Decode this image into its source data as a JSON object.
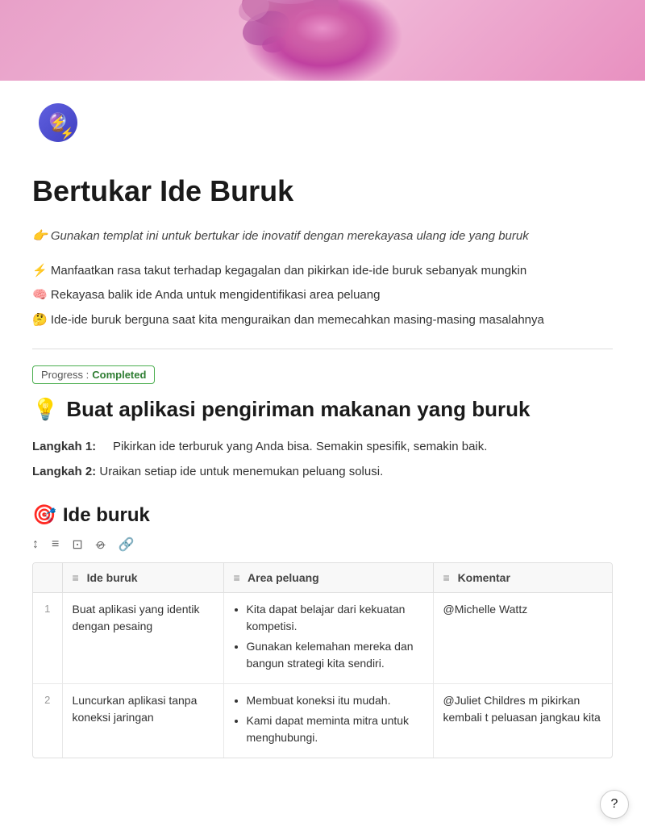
{
  "header": {
    "banner_alt": "Pink decorative header banner"
  },
  "app_icon": {
    "emoji": "🔮⚡"
  },
  "page": {
    "title": "Bertukar Ide Buruk",
    "intro_emoji": "👉",
    "intro_text": "Gunakan templat ini untuk bertukar ide inovatif dengan merekayasa ulang ide yang buruk",
    "bullets": [
      {
        "emoji": "⚡",
        "text": "Manfaatkan rasa takut terhadap kegagalan dan pikirkan ide-ide buruk sebanyak mungkin"
      },
      {
        "emoji": "🧠",
        "text": "Rekayasa balik ide Anda untuk mengidentifikasi area peluang"
      },
      {
        "emoji": "🤔",
        "text": "Ide-ide buruk berguna saat kita menguraikan dan memecahkan masing-masing masalahnya"
      }
    ]
  },
  "progress": {
    "label": "Progress : ",
    "status": "Completed"
  },
  "section1": {
    "emoji": "💡",
    "title": "Buat aplikasi pengiriman makanan yang buruk",
    "steps": [
      {
        "label": "Langkah 1:",
        "text": "Pikirkan ide terburuk yang Anda bisa. Semakin spesifik, semakin baik."
      },
      {
        "label": "Langkah 2:",
        "text": "Uraikan setiap ide untuk menemukan peluang solusi."
      }
    ]
  },
  "section2": {
    "emoji": "🎯",
    "title": "Ide buruk",
    "toolbar": [
      "↕",
      "≡",
      "⊡",
      "⊘",
      "🔗"
    ]
  },
  "table": {
    "headers": [
      {
        "icon": "≡",
        "label": "Ide buruk"
      },
      {
        "icon": "≡",
        "label": "Area peluang"
      },
      {
        "icon": "≡",
        "label": "Komentar"
      }
    ],
    "rows": [
      {
        "num": "1",
        "ide_buruk": "Buat aplikasi yang identik dengan pesaing",
        "area_peluang": [
          "Kita dapat belajar dari kekuatan kompetisi.",
          "Gunakan kelemahan mereka dan bangun strategi kita sendiri."
        ],
        "komentar": "@Michelle Wattz"
      },
      {
        "num": "2",
        "ide_buruk": "Luncurkan aplikasi tanpa koneksi jaringan",
        "area_peluang": [
          "Membuat koneksi itu mudah.",
          "Kami dapat meminta mitra untuk menghubungi."
        ],
        "komentar": "@Juliet Childres m pikirkan kembali t peluasan jangkau kita"
      }
    ]
  },
  "help_button": {
    "label": "?"
  }
}
